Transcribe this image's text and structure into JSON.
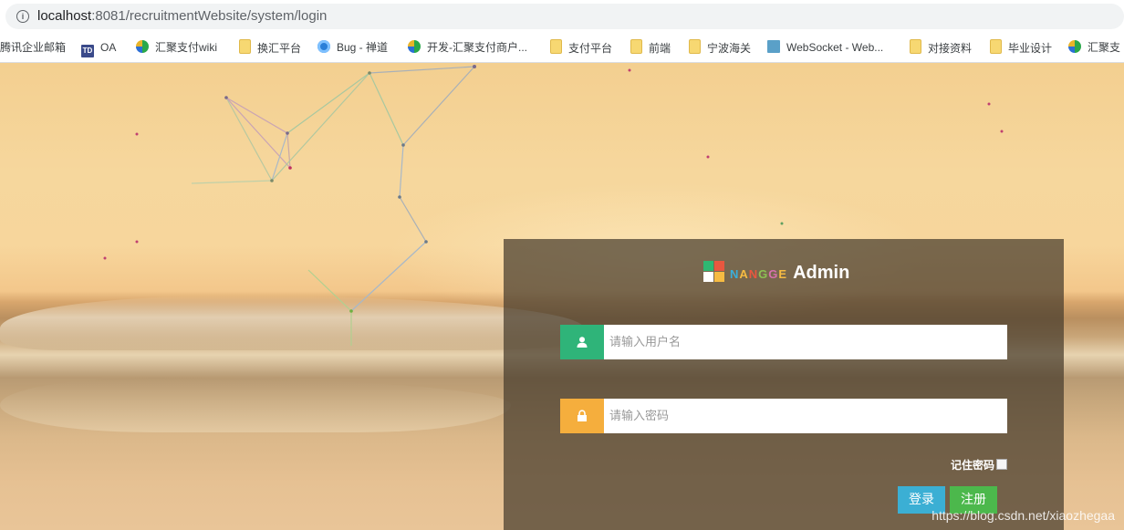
{
  "browser": {
    "url_host": "localhost",
    "url_path": ":8081/recruitmentWebsite/system/login"
  },
  "bookmarks": [
    {
      "label": "腾讯企业邮箱",
      "icon": "none"
    },
    {
      "label": "OA",
      "icon": "td-icon"
    },
    {
      "label": "汇聚支付wiki",
      "icon": "huiju-icon"
    },
    {
      "label": "换汇平台",
      "icon": "folder-icon"
    },
    {
      "label": "Bug - 禅道",
      "icon": "bug-icon"
    },
    {
      "label": "开发-汇聚支付商户...",
      "icon": "huiju-icon"
    },
    {
      "label": "支付平台",
      "icon": "folder-icon"
    },
    {
      "label": "前端",
      "icon": "folder-icon"
    },
    {
      "label": "宁波海关",
      "icon": "folder-icon"
    },
    {
      "label": "WebSocket - Web...",
      "icon": "websocket-icon"
    },
    {
      "label": "对接资料",
      "icon": "folder-icon"
    },
    {
      "label": "毕业设计",
      "icon": "folder-icon"
    },
    {
      "label": "汇聚支",
      "icon": "huiju-icon"
    }
  ],
  "login": {
    "brand_letters": [
      "N",
      "A",
      "N",
      "G",
      "G",
      "E"
    ],
    "brand_admin": "Admin",
    "username_placeholder": "请输入用户名",
    "password_placeholder": "请输入密码",
    "remember_label": "记住密码",
    "login_button": "登录",
    "register_button": "注册"
  },
  "watermark": "https://blog.csdn.net/xiaozhegaa",
  "colors": {
    "user_icon_bg": "#2fb479",
    "pass_icon_bg": "#f5ae3d",
    "login_btn": "#3bafd4",
    "register_btn": "#4cb84c"
  }
}
